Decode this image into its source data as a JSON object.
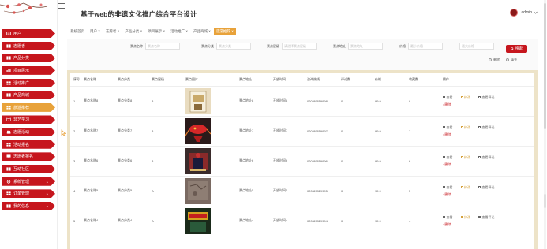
{
  "header": {
    "title": "基于web的非遗文化推广综合平台设计",
    "username": "admin",
    "dropdown_icon": "chevron-down-icon"
  },
  "sidebar": {
    "items": [
      {
        "label": "用户",
        "icon": "user-icon",
        "active": false,
        "arrow": false
      },
      {
        "label": "志愿者",
        "icon": "grid-icon",
        "active": false,
        "arrow": false
      },
      {
        "label": "产品分类",
        "icon": "grid-icon",
        "active": false,
        "arrow": false
      },
      {
        "label": "项目展示",
        "icon": "chart-icon",
        "active": false,
        "arrow": false
      },
      {
        "label": "活动推广",
        "icon": "doc-icon",
        "active": false,
        "arrow": false
      },
      {
        "label": "产品商城",
        "icon": "cart-icon",
        "active": false,
        "arrow": false
      },
      {
        "label": "旅游推荐",
        "icon": "grid-icon",
        "active": true,
        "arrow": false
      },
      {
        "label": "非艺学习",
        "icon": "book-icon",
        "active": false,
        "arrow": false
      },
      {
        "label": "志愿活动",
        "icon": "people-icon",
        "active": false,
        "arrow": false
      },
      {
        "label": "活动报名",
        "icon": "list-icon",
        "active": false,
        "arrow": false
      },
      {
        "label": "志愿者报名",
        "icon": "monitor-icon",
        "active": false,
        "arrow": false
      },
      {
        "label": "互动社区",
        "icon": "grid-icon",
        "active": false,
        "arrow": false
      },
      {
        "label": "系统管理",
        "icon": "gear-icon",
        "active": false,
        "arrow": true
      },
      {
        "label": "订单管理",
        "icon": "order-icon",
        "active": false,
        "arrow": true
      },
      {
        "label": "我的信息",
        "icon": "info-icon",
        "active": false,
        "arrow": true
      }
    ]
  },
  "tabs": [
    {
      "label": "系统首页",
      "close": "",
      "active": false
    },
    {
      "label": "用户",
      "close": "×",
      "active": false
    },
    {
      "label": "志愿者",
      "close": "×",
      "active": false
    },
    {
      "label": "产品分类",
      "close": "×",
      "active": false
    },
    {
      "label": "项目展示",
      "close": "×",
      "active": false
    },
    {
      "label": "活动推广",
      "close": "×",
      "active": false
    },
    {
      "label": "产品商城",
      "close": "×",
      "active": false
    },
    {
      "label": "旅游推荐",
      "close": "×",
      "active": true
    }
  ],
  "search": {
    "fields": [
      {
        "label": "景点名称",
        "placeholder": "景点名称"
      },
      {
        "label": "景点分类",
        "placeholder": "景点分类"
      },
      {
        "label": "景点星级",
        "placeholder": "请选择景点星级"
      },
      {
        "label": "景点地址",
        "placeholder": "景点地址"
      },
      {
        "label": "价格",
        "placeholder": "最小价格"
      },
      {
        "label": "",
        "placeholder": "最大价格"
      }
    ],
    "search_button": "搜索"
  },
  "actions": {
    "delete_label": "删除",
    "add_label": "填充"
  },
  "table": {
    "headers": [
      "序号",
      "景点名称",
      "景点分类",
      "景点星级",
      "景点图片",
      "景点地址",
      "开放时间",
      "咨询热线",
      "评论数",
      "价格",
      "收藏数",
      "操作"
    ],
    "rows": [
      {
        "index": "1",
        "name": "景点名称8",
        "category": "景点分类8",
        "star": "A",
        "address": "景点地址8",
        "time": "开放时间8",
        "phone": "020-89819998",
        "comments": "0",
        "price": "99.9",
        "favorites": "8",
        "img": "scroll"
      },
      {
        "index": "2",
        "name": "景点名称7",
        "category": "景点分类7",
        "star": "A",
        "address": "景点地址7",
        "time": "开放时间7",
        "phone": "020-89819997",
        "comments": "0",
        "price": "99.9",
        "favorites": "7",
        "img": "kite"
      },
      {
        "index": "3",
        "name": "景点名称6",
        "category": "景点分类6",
        "star": "A",
        "address": "景点地址6",
        "time": "开放时间6",
        "phone": "020-89819996",
        "comments": "0",
        "price": "99.9",
        "favorites": "6",
        "img": "gate"
      },
      {
        "index": "4",
        "name": "景点名称5",
        "category": "景点分类5",
        "star": "A",
        "address": "景点地址5",
        "time": "开放时间5",
        "phone": "020-89819995",
        "comments": "0",
        "price": "99.9",
        "favorites": "5",
        "img": "stone"
      },
      {
        "index": "5",
        "name": "景点名称4",
        "category": "景点分类4",
        "star": "A",
        "address": "景点地址4",
        "time": "开放时间4",
        "phone": "020-89819994",
        "comments": "0",
        "price": "99.9",
        "favorites": "4",
        "img": "poster"
      }
    ],
    "op_view": "查看",
    "op_edit": "修改",
    "op_comments": "查看评论",
    "op_delete": "删除"
  },
  "colors": {
    "primary": "#c6161d",
    "active": "#e8a23a",
    "border": "#ede3c8"
  }
}
